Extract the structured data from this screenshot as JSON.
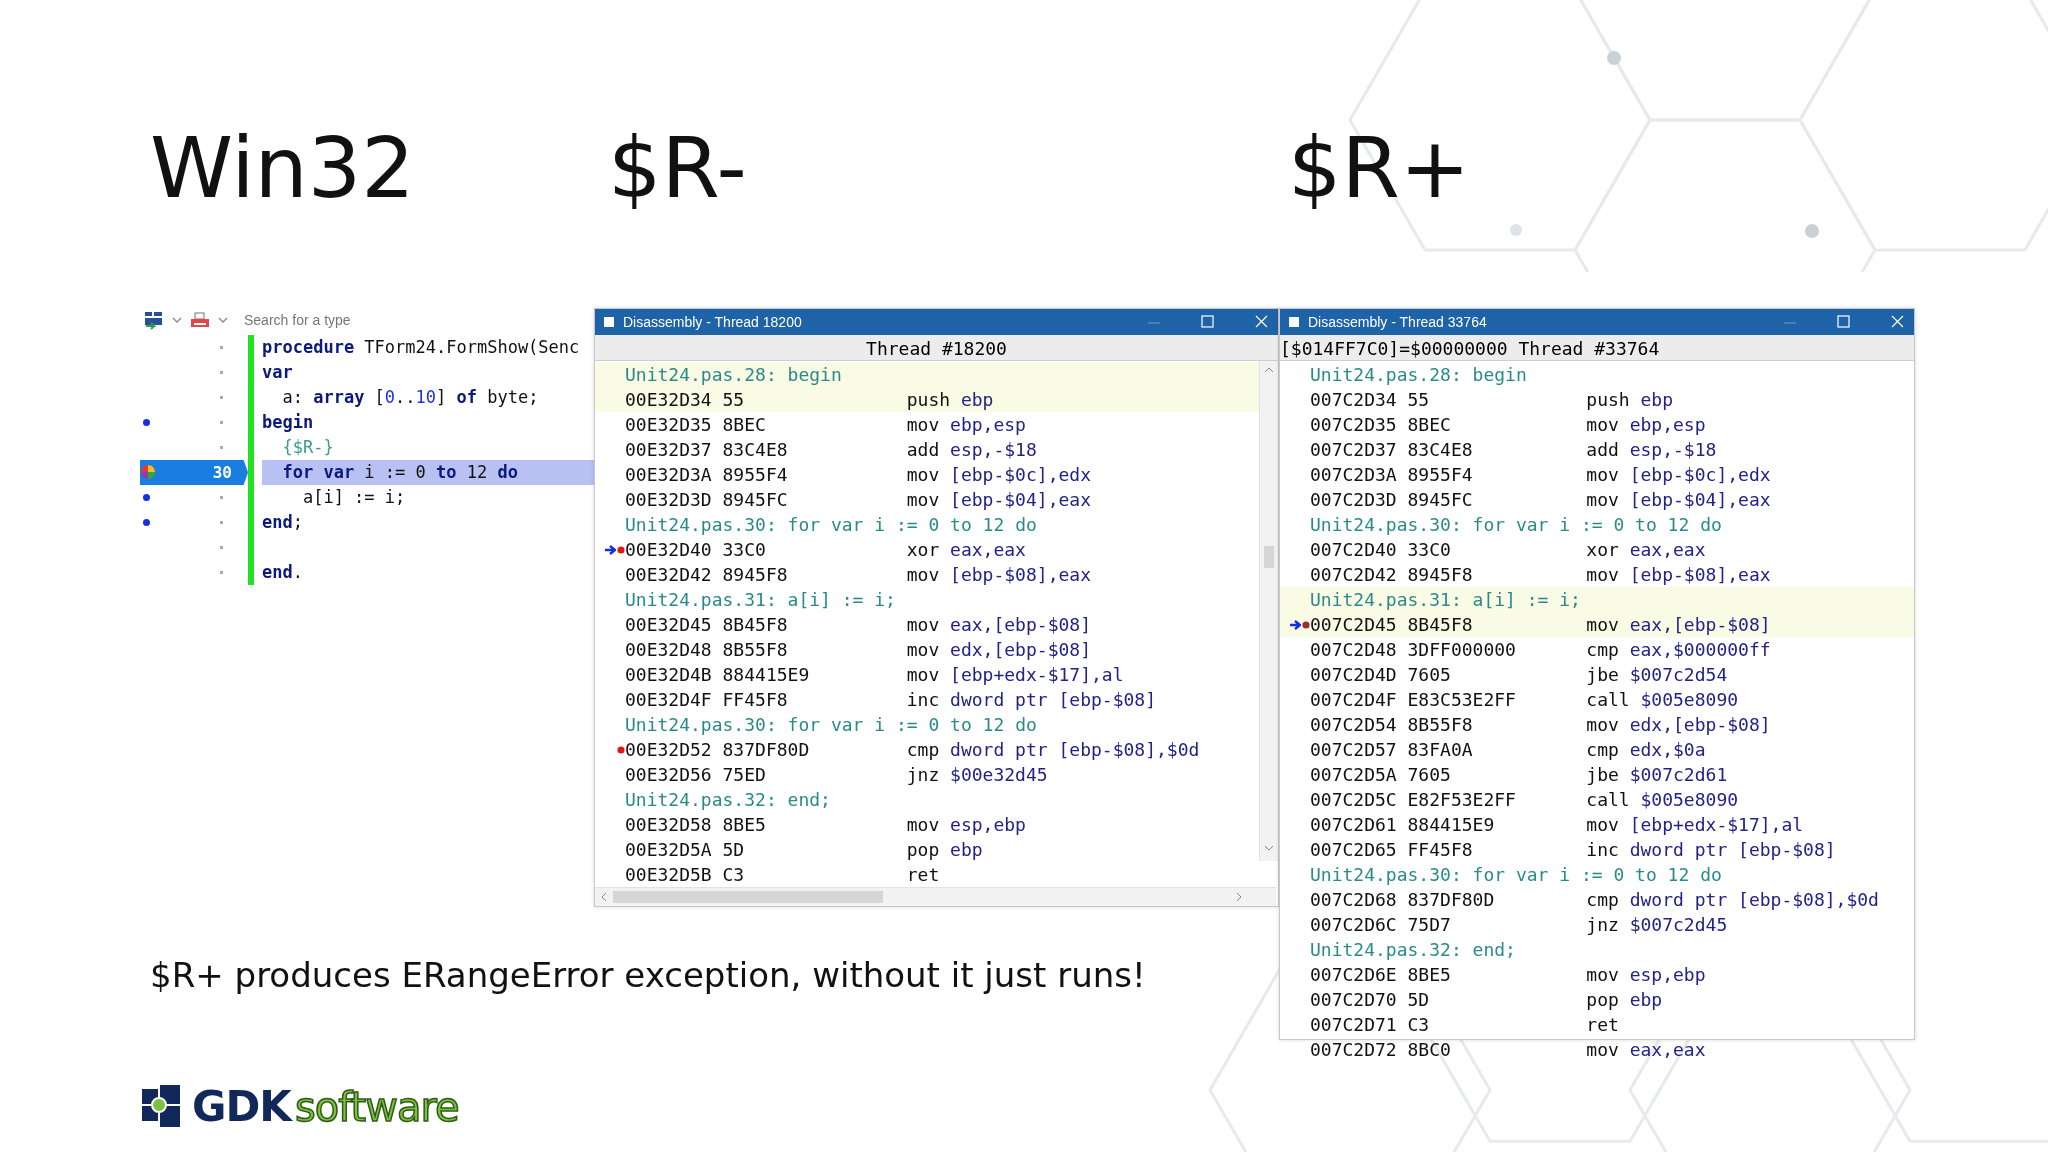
{
  "headings": [
    "Win32",
    "$R-",
    "$R+"
  ],
  "editor": {
    "search": {
      "placeholder": "Search for a type"
    },
    "lines": [
      {
        "tokens": [
          {
            "kind": "kw",
            "text": "procedure"
          },
          {
            "kind": "text",
            "text": " TForm24.FormShow(Senc"
          }
        ],
        "compiled": false,
        "current": false
      },
      {
        "tokens": [
          {
            "kind": "kw",
            "text": "var"
          }
        ],
        "compiled": false,
        "current": false
      },
      {
        "tokens": [
          {
            "kind": "text",
            "text": "  a: "
          },
          {
            "kind": "kw",
            "text": "array"
          },
          {
            "kind": "text",
            "text": " ["
          },
          {
            "kind": "num",
            "text": "0"
          },
          {
            "kind": "text",
            "text": ".."
          },
          {
            "kind": "num",
            "text": "10"
          },
          {
            "kind": "text",
            "text": "] "
          },
          {
            "kind": "kw",
            "text": "of"
          },
          {
            "kind": "text",
            "text": " byte;"
          }
        ],
        "compiled": false,
        "current": false
      },
      {
        "tokens": [
          {
            "kind": "kw",
            "text": "begin"
          }
        ],
        "compiled": true,
        "current": false
      },
      {
        "tokens": [
          {
            "kind": "dir",
            "text": "  {$R-}"
          }
        ],
        "compiled": false,
        "current": false
      },
      {
        "tokens": [
          {
            "kind": "kw",
            "text": "  for var"
          },
          {
            "kind": "text",
            "text": " i := 0 "
          },
          {
            "kind": "kw",
            "text": "to"
          },
          {
            "kind": "text",
            "text": " 12 "
          },
          {
            "kind": "kw",
            "text": "do"
          }
        ],
        "line_number": "30",
        "compiled": false,
        "current": true
      },
      {
        "tokens": [
          {
            "kind": "text",
            "text": "    a[i] := i;"
          }
        ],
        "compiled": true,
        "current": false
      },
      {
        "tokens": [
          {
            "kind": "kw",
            "text": "end"
          },
          {
            "kind": "text",
            "text": ";"
          }
        ],
        "compiled": true,
        "current": false
      },
      {
        "compiled": false,
        "current": false
      },
      {
        "tokens": [
          {
            "kind": "kw",
            "text": "end"
          },
          {
            "kind": "text",
            "text": "."
          }
        ],
        "compiled": false,
        "current": false
      }
    ]
  },
  "windows": [
    {
      "title": "Disassembly - Thread 18200",
      "header": "Thread #18200",
      "scrollbars": true,
      "rows": [
        {
          "kind": "source",
          "text": "Unit24.pas.28: begin",
          "highlighted": true
        },
        {
          "kind": "instr",
          "address": "00E32D34 55",
          "op": "push",
          "args": "ebp",
          "highlighted": true,
          "current": false,
          "breakpoint": false
        },
        {
          "kind": "instr",
          "address": "00E32D35 8BEC",
          "op": "mov",
          "args": "ebp,esp",
          "highlighted": false,
          "current": false,
          "breakpoint": false
        },
        {
          "kind": "instr",
          "address": "00E32D37 83C4E8",
          "op": "add",
          "args": "esp,-$18",
          "highlighted": false,
          "current": false,
          "breakpoint": false
        },
        {
          "kind": "instr",
          "address": "00E32D3A 8955F4",
          "op": "mov",
          "args": "[ebp-$0c],edx",
          "highlighted": false,
          "current": false,
          "breakpoint": false
        },
        {
          "kind": "instr",
          "address": "00E32D3D 8945FC",
          "op": "mov",
          "args": "[ebp-$04],eax",
          "highlighted": false,
          "current": false,
          "breakpoint": false
        },
        {
          "kind": "source",
          "text": "Unit24.pas.30: for var i := 0 to 12 do",
          "highlighted": false
        },
        {
          "kind": "instr",
          "address": "00E32D40 33C0",
          "op": "xor",
          "args": "eax,eax",
          "highlighted": false,
          "current": true,
          "breakpoint": true
        },
        {
          "kind": "instr",
          "address": "00E32D42 8945F8",
          "op": "mov",
          "args": "[ebp-$08],eax",
          "highlighted": false,
          "current": false,
          "breakpoint": false
        },
        {
          "kind": "source",
          "text": "Unit24.pas.31: a[i] := i;",
          "highlighted": false
        },
        {
          "kind": "instr",
          "address": "00E32D45 8B45F8",
          "op": "mov",
          "args": "eax,[ebp-$08]",
          "highlighted": false,
          "current": false,
          "breakpoint": false
        },
        {
          "kind": "instr",
          "address": "00E32D48 8B55F8",
          "op": "mov",
          "args": "edx,[ebp-$08]",
          "highlighted": false,
          "current": false,
          "breakpoint": false
        },
        {
          "kind": "instr",
          "address": "00E32D4B 884415E9",
          "op": "mov",
          "args": "[ebp+edx-$17],al",
          "highlighted": false,
          "current": false,
          "breakpoint": false
        },
        {
          "kind": "instr",
          "address": "00E32D4F FF45F8",
          "op": "inc",
          "args": "dword ptr [ebp-$08]",
          "highlighted": false,
          "current": false,
          "breakpoint": false
        },
        {
          "kind": "source",
          "text": "Unit24.pas.30: for var i := 0 to 12 do",
          "highlighted": false
        },
        {
          "kind": "instr",
          "address": "00E32D52 837DF80D",
          "op": "cmp",
          "args": "dword ptr [ebp-$08],$0d",
          "highlighted": false,
          "current": false,
          "breakpoint": true
        },
        {
          "kind": "instr",
          "address": "00E32D56 75ED",
          "op": "jnz",
          "args": "$00e32d45",
          "highlighted": false,
          "current": false,
          "breakpoint": false
        },
        {
          "kind": "source",
          "text": "Unit24.pas.32: end;",
          "highlighted": false
        },
        {
          "kind": "instr",
          "address": "00E32D58 8BE5",
          "op": "mov",
          "args": "esp,ebp",
          "highlighted": false,
          "current": false,
          "breakpoint": false
        },
        {
          "kind": "instr",
          "address": "00E32D5A 5D",
          "op": "pop",
          "args": "ebp",
          "highlighted": false,
          "current": false,
          "breakpoint": false
        },
        {
          "kind": "instr",
          "address": "00E32D5B C3",
          "op": "ret",
          "highlighted": false,
          "current": false,
          "breakpoint": false
        }
      ]
    },
    {
      "title": "Disassembly - Thread 33764",
      "header": "[$014FF7C0]=$00000000 Thread #33764",
      "scrollbars": false,
      "rows": [
        {
          "kind": "source",
          "text": "Unit24.pas.28: begin",
          "highlighted": false
        },
        {
          "kind": "instr",
          "address": "007C2D34 55",
          "op": "push",
          "args": "ebp",
          "highlighted": false,
          "current": false,
          "breakpoint": false
        },
        {
          "kind": "instr",
          "address": "007C2D35 8BEC",
          "op": "mov",
          "args": "ebp,esp",
          "highlighted": false,
          "current": false,
          "breakpoint": false
        },
        {
          "kind": "instr",
          "address": "007C2D37 83C4E8",
          "op": "add",
          "args": "esp,-$18",
          "highlighted": false,
          "current": false,
          "breakpoint": false
        },
        {
          "kind": "instr",
          "address": "007C2D3A 8955F4",
          "op": "mov",
          "args": "[ebp-$0c],edx",
          "highlighted": false,
          "current": false,
          "breakpoint": false
        },
        {
          "kind": "instr",
          "address": "007C2D3D 8945FC",
          "op": "mov",
          "args": "[ebp-$04],eax",
          "highlighted": false,
          "current": false,
          "breakpoint": false
        },
        {
          "kind": "source",
          "text": "Unit24.pas.30: for var i := 0 to 12 do",
          "highlighted": false
        },
        {
          "kind": "instr",
          "address": "007C2D40 33C0",
          "op": "xor",
          "args": "eax,eax",
          "highlighted": false,
          "current": false,
          "breakpoint": false
        },
        {
          "kind": "instr",
          "address": "007C2D42 8945F8",
          "op": "mov",
          "args": "[ebp-$08],eax",
          "highlighted": false,
          "current": false,
          "breakpoint": false
        },
        {
          "kind": "source",
          "text": "Unit24.pas.31: a[i] := i;",
          "highlighted": true
        },
        {
          "kind": "instr",
          "address": "007C2D45 8B45F8",
          "op": "mov",
          "args": "eax,[ebp-$08]",
          "highlighted": true,
          "current": true,
          "breakpoint": true
        },
        {
          "kind": "instr",
          "address": "007C2D48 3DFF000000",
          "op": "cmp",
          "args": "eax,$000000ff",
          "highlighted": false,
          "current": false,
          "breakpoint": false
        },
        {
          "kind": "instr",
          "address": "007C2D4D 7605",
          "op": "jbe",
          "args": "$007c2d54",
          "highlighted": false,
          "current": false,
          "breakpoint": false
        },
        {
          "kind": "instr",
          "address": "007C2D4F E83C53E2FF",
          "op": "call",
          "args": "$005e8090",
          "highlighted": false,
          "current": false,
          "breakpoint": false
        },
        {
          "kind": "instr",
          "address": "007C2D54 8B55F8",
          "op": "mov",
          "args": "edx,[ebp-$08]",
          "highlighted": false,
          "current": false,
          "breakpoint": false
        },
        {
          "kind": "instr",
          "address": "007C2D57 83FA0A",
          "op": "cmp",
          "args": "edx,$0a",
          "highlighted": false,
          "current": false,
          "breakpoint": false
        },
        {
          "kind": "instr",
          "address": "007C2D5A 7605",
          "op": "jbe",
          "args": "$007c2d61",
          "highlighted": false,
          "current": false,
          "breakpoint": false
        },
        {
          "kind": "instr",
          "address": "007C2D5C E82F53E2FF",
          "op": "call",
          "args": "$005e8090",
          "highlighted": false,
          "current": false,
          "breakpoint": false
        },
        {
          "kind": "instr",
          "address": "007C2D61 884415E9",
          "op": "mov",
          "args": "[ebp+edx-$17],al",
          "highlighted": false,
          "current": false,
          "breakpoint": false
        },
        {
          "kind": "instr",
          "address": "007C2D65 FF45F8",
          "op": "inc",
          "args": "dword ptr [ebp-$08]",
          "highlighted": false,
          "current": false,
          "breakpoint": false
        },
        {
          "kind": "source",
          "text": "Unit24.pas.30: for var i := 0 to 12 do",
          "highlighted": false
        },
        {
          "kind": "instr",
          "address": "007C2D68 837DF80D",
          "op": "cmp",
          "args": "dword ptr [ebp-$08],$0d",
          "highlighted": false,
          "current": false,
          "breakpoint": false
        },
        {
          "kind": "instr",
          "address": "007C2D6C 75D7",
          "op": "jnz",
          "args": "$007c2d45",
          "highlighted": false,
          "current": false,
          "breakpoint": false
        },
        {
          "kind": "source",
          "text": "Unit24.pas.32: end;",
          "highlighted": false
        },
        {
          "kind": "instr",
          "address": "007C2D6E 8BE5",
          "op": "mov",
          "args": "esp,ebp",
          "highlighted": false,
          "current": false,
          "breakpoint": false
        },
        {
          "kind": "instr",
          "address": "007C2D70 5D",
          "op": "pop",
          "args": "ebp",
          "highlighted": false,
          "current": false,
          "breakpoint": false
        },
        {
          "kind": "instr",
          "address": "007C2D71 C3",
          "op": "ret",
          "highlighted": false,
          "current": false,
          "breakpoint": false
        },
        {
          "kind": "instr",
          "address": "007C2D72 8BC0",
          "op": "mov",
          "args": "eax,eax",
          "highlighted": false,
          "current": false,
          "breakpoint": false
        }
      ]
    }
  ],
  "caption": "$R+ produces ERangeError exception, without it just runs!",
  "logo": {
    "name": "GDK",
    "tagline": "software"
  }
}
